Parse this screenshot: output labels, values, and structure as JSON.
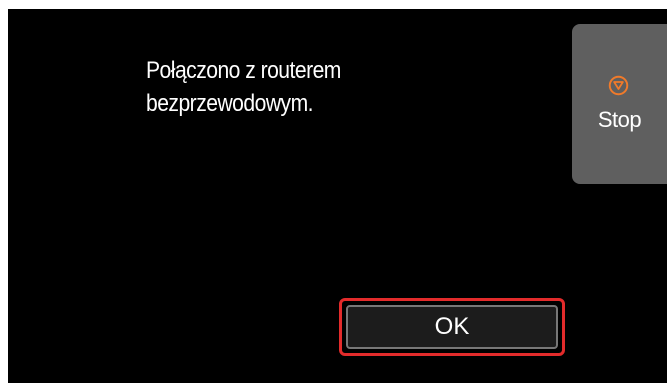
{
  "dialog": {
    "message_lines": [
      "Połączono z routerem",
      "bezprzewodowym."
    ],
    "ok_label": "OK"
  },
  "sidebar": {
    "stop_label": "Stop",
    "stop_icon": "stop-icon"
  },
  "colors": {
    "screen_background": "#000000",
    "stop_button_background": "#5f5f5f",
    "stop_icon_orange": "#f07a2a",
    "highlight_red": "#e32b2b",
    "ok_button_background": "#1c1c1c",
    "text": "#ffffff"
  }
}
